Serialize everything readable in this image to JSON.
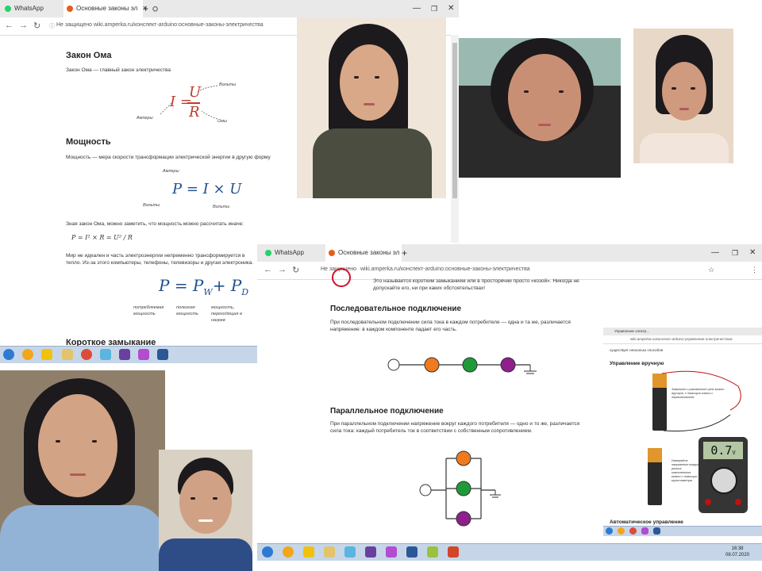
{
  "browser1": {
    "tabs": [
      {
        "label": "WhatsApp"
      },
      {
        "label": "Основные законы эл"
      }
    ],
    "url_prefix": "Не защищено",
    "url": "wiki.amperka.ru/конспект-arduino:основные-законы-электричества",
    "ohm": {
      "title": "Закон Ома",
      "text": "Закон Ома — главный закон электричества",
      "formula_left": "I =",
      "formula_num": "U",
      "formula_den": "R",
      "lbl_volts": "Вольты",
      "lbl_amps": "Амперы",
      "lbl_ohms": "Омы"
    },
    "power": {
      "title": "Мощность",
      "text": "Мощность — мера скорости трансформации электрической энергии в другую форму",
      "formula": "P = I × U",
      "lbl_amps": "Амперы",
      "lbl_volts_l": "Вольты",
      "lbl_volts_r": "Вольты",
      "text2": "Зная закон Ома, можно заметить, что мощность можно рассчитать иначе:",
      "formula2": "P = I² × R = U² / R",
      "text3": "Мир не идеален и часть электроэнергии непременно трансформируется в тепло. Из-за этого компьютеры, телефоны, телевизоры и другая электроника.",
      "formula3": "P = P",
      "sub_w": "W",
      "plus": "+ P",
      "sub_d": "D",
      "lbl_consumed": "потребляемая мощность",
      "lbl_useful": "полезная мощность",
      "lbl_lost": "мощность, переходящая в нагрев"
    },
    "short_title": "Короткое замыкание"
  },
  "browser2": {
    "tabs": [
      {
        "label": "WhatsApp"
      },
      {
        "label": "Основные законы эл"
      }
    ],
    "url_prefix": "Не защищено",
    "url": "wiki.amperka.ru/конспект-arduino:основные-законы-электричества",
    "short_text": "Это называется коротким замыканием или в просторечии просто «козой». Никогда не допускайте его, ни при каких обстоятельствах!",
    "series": {
      "title": "Последовательное подключение",
      "text": "При последовательном подключении сила тока в каждом потребителе — одна и та же, различается напряжение: в каждом компоненте падает его часть."
    },
    "parallel": {
      "title": "Параллельное подключение",
      "text": "При параллельном подключении напряжение вокруг каждого потребителя — одно и то же, различается сила тока: каждый потребитель ток в соответствии с собственным сопротивлением."
    },
    "clock": {
      "time": "16:38",
      "date": "08.07.2020"
    }
  },
  "browser3": {
    "tab": "Управление электр...",
    "url": "wiki.amperka.ru/конспект-arduino:управление-электричеством",
    "text_top": "существует несколько способов",
    "manual_title": "Управление вручную",
    "auto_title": "Автоматическое управление",
    "meter_value": "0.7",
    "meter_unit": "V",
    "note1": "Замкните и разомкните цепь можно вручную, с помощью ключа и переключателя",
    "note2": "Измеряйте напряжение вокруг разных компонентов можно с помощью мультиметра"
  },
  "colors": {
    "orange": "#f07a1e",
    "green": "#1f9a3a",
    "purple": "#8e1f8c",
    "taskbar": "#c6d6e8",
    "formula_red": "#c0392b",
    "formula_blue": "#1e4f8c"
  }
}
